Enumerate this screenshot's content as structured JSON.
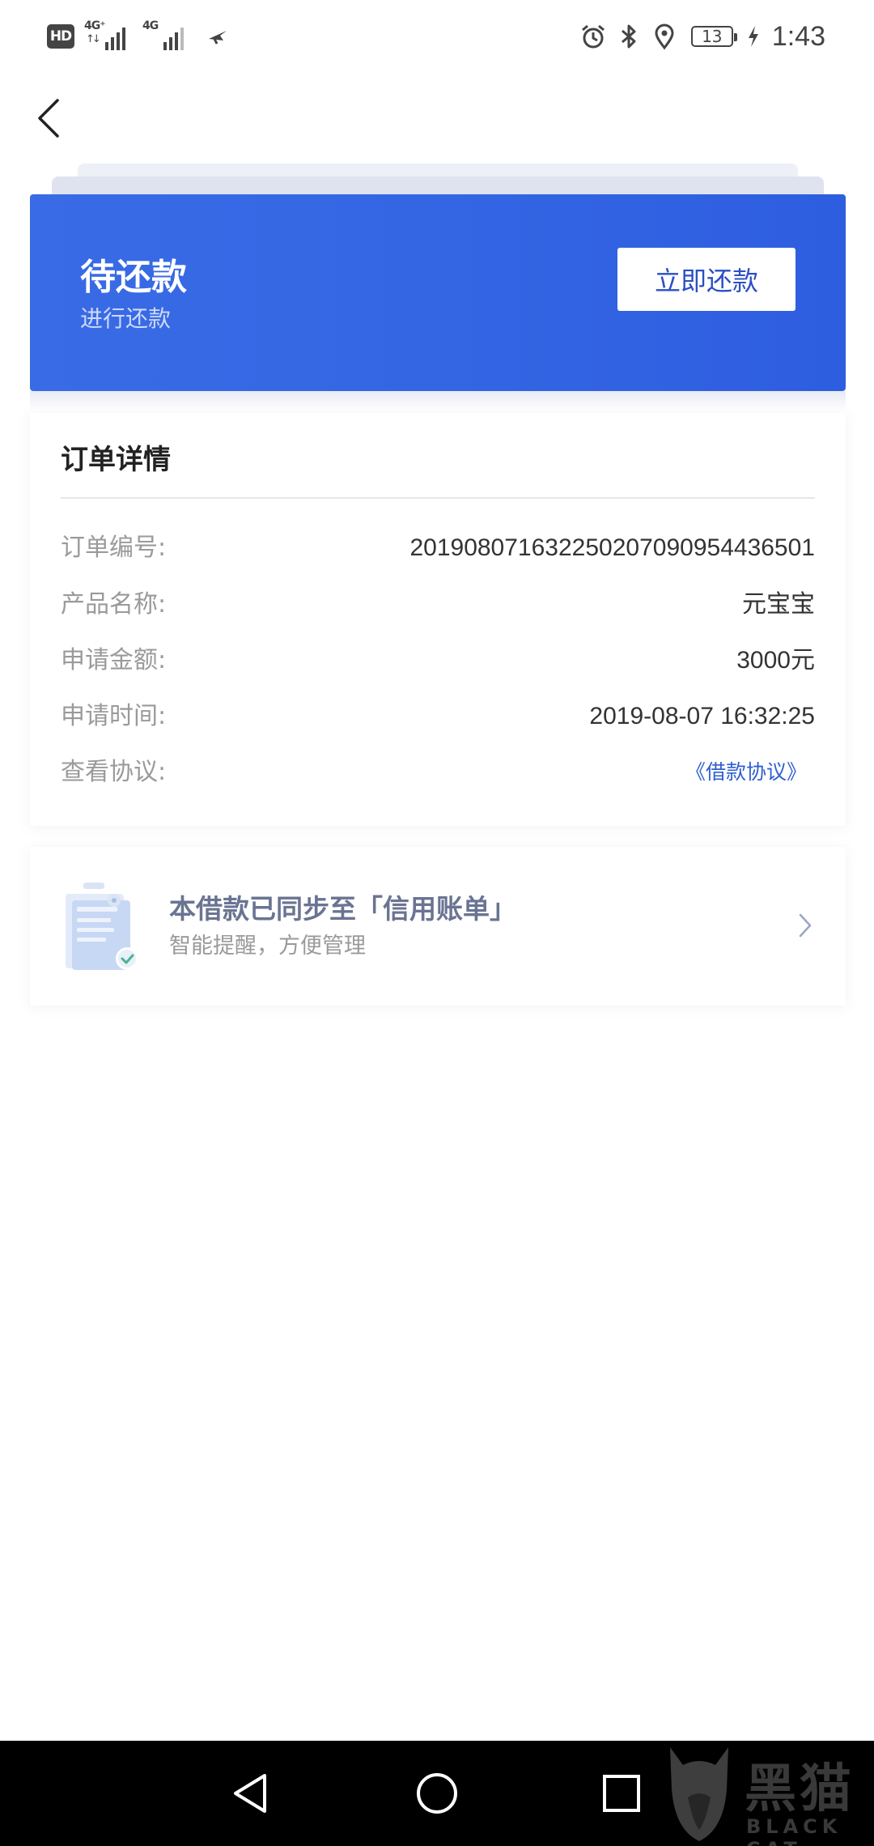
{
  "status_bar": {
    "hd_label": "HD",
    "network1_label": "4G⁺",
    "network1_arrows": "↑↓",
    "network2_label": "4G",
    "battery_level": "13",
    "time": "1:43",
    "icons": [
      "alarm-icon",
      "bluetooth-icon",
      "location-icon",
      "battery-icon",
      "charging-icon"
    ]
  },
  "nav": {
    "back_icon": "chevron-left-icon"
  },
  "status_card": {
    "title": "待还款",
    "subtitle": "进行还款",
    "button_label": "立即还款",
    "color": "#3567e4"
  },
  "order_details": {
    "title": "订单详情",
    "rows": [
      {
        "label": "订单编号:",
        "value": "201908071632250207090954436501"
      },
      {
        "label": "产品名称:",
        "value": "元宝宝"
      },
      {
        "label": "申请金额:",
        "value": "3000元"
      },
      {
        "label": "申请时间:",
        "value": "2019-08-07 16:32:25"
      },
      {
        "label": "查看协议:",
        "value": "《借款协议》"
      }
    ],
    "link_color": "#2f5fd0"
  },
  "sync_banner": {
    "title": "本借款已同步至「信用账单」",
    "subtitle": "智能提醒，方便管理",
    "icon": "document-check-icon"
  },
  "system_nav": {
    "buttons": [
      "back-triangle-icon",
      "home-circle-icon",
      "recents-square-icon"
    ]
  },
  "watermark": {
    "text": "黑猫",
    "sub": "BLACK CAT"
  }
}
